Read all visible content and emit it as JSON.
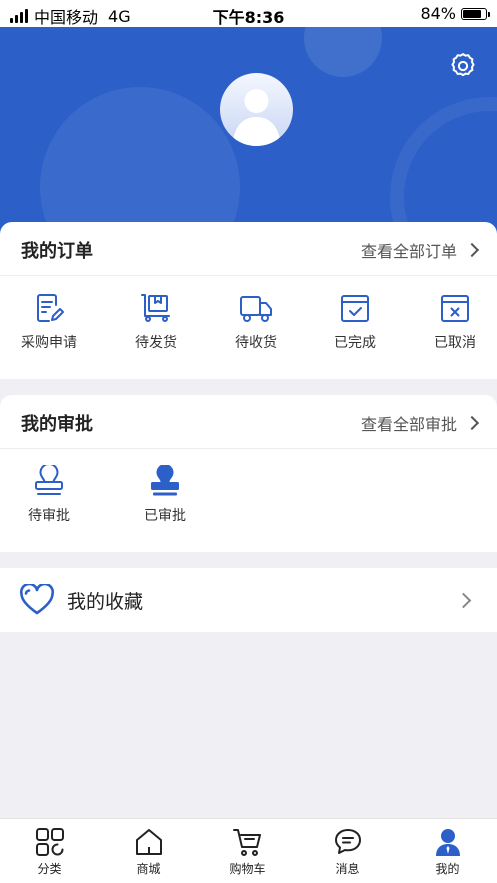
{
  "status_bar": {
    "carrier": "中国移动",
    "network": "4G",
    "time": "下午8:36",
    "battery_text": "84%",
    "battery_level": 0.84
  },
  "header": {
    "settings_icon": "gear-icon",
    "avatar_icon": "user-avatar-icon"
  },
  "orders": {
    "title": "我的订单",
    "view_all": "查看全部订单",
    "items": [
      {
        "label": "采购申请",
        "icon": "purchase-request-icon"
      },
      {
        "label": "待发货",
        "icon": "box-icon"
      },
      {
        "label": "待收货",
        "icon": "truck-icon"
      },
      {
        "label": "已完成",
        "icon": "calendar-check-icon"
      },
      {
        "label": "已取消",
        "icon": "calendar-cancel-icon"
      }
    ]
  },
  "approvals": {
    "title": "我的审批",
    "view_all": "查看全部审批",
    "items": [
      {
        "label": "待审批",
        "icon": "stamp-outline-icon"
      },
      {
        "label": "已审批",
        "icon": "stamp-filled-icon"
      }
    ]
  },
  "favorites": {
    "label": "我的收藏",
    "icon": "heart-icon"
  },
  "tabbar": {
    "items": [
      {
        "label": "分类",
        "icon": "category-grid-icon"
      },
      {
        "label": "商城",
        "icon": "home-icon"
      },
      {
        "label": "购物车",
        "icon": "cart-icon"
      },
      {
        "label": "消息",
        "icon": "chat-icon"
      },
      {
        "label": "我的",
        "icon": "user-icon",
        "active": true
      }
    ]
  },
  "colors": {
    "primary": "#2c5fc7",
    "background": "#efeff4"
  }
}
